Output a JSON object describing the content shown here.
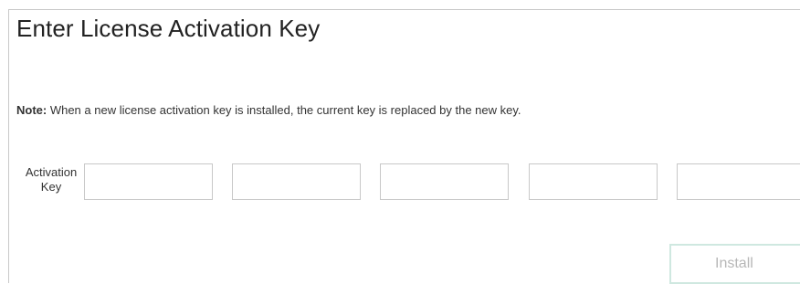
{
  "page": {
    "title": "Enter License Activation Key"
  },
  "note": {
    "label": "Note:",
    "text": " When a new license activation key is installed, the current key is replaced by the new key."
  },
  "activation_key": {
    "label_line1": "Activation",
    "label_line2": "Key",
    "fields": [
      "",
      "",
      "",
      "",
      ""
    ]
  },
  "actions": {
    "install_label": "Install"
  }
}
